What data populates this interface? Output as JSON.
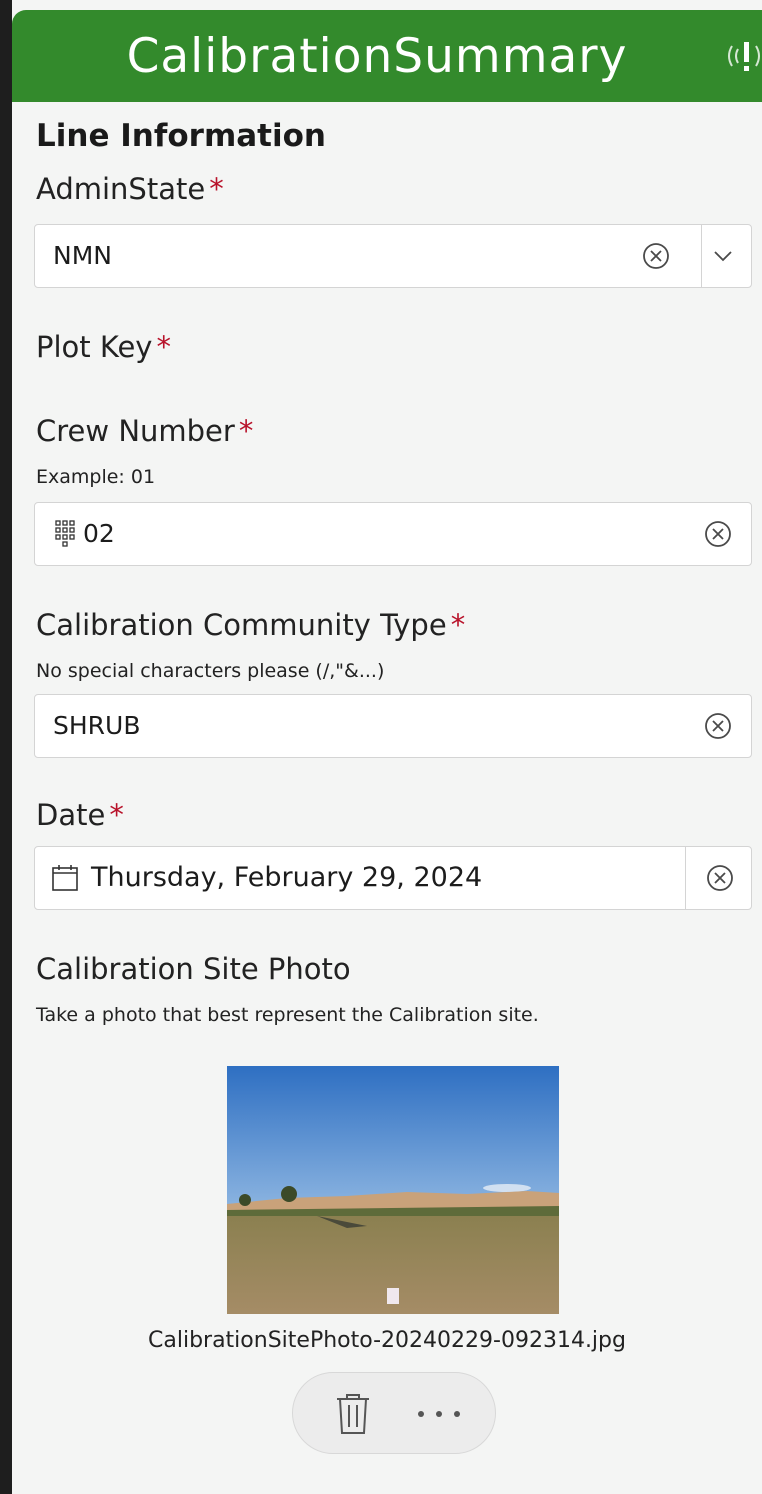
{
  "header": {
    "title": "CalibrationSummary",
    "gps_icon": "gps-warning-icon"
  },
  "section": {
    "title": "Line Information"
  },
  "fields": {
    "admin_state": {
      "label": "AdminState",
      "required_mark": "*",
      "value": "NMN"
    },
    "plot_key": {
      "label": "Plot Key",
      "required_mark": "*"
    },
    "crew_number": {
      "label": "Crew Number",
      "required_mark": "*",
      "hint": "Example: 01",
      "value": "02"
    },
    "community_type": {
      "label": "Calibration Community Type",
      "required_mark": "*",
      "hint": "No special characters please (/,\"&...)",
      "value": "SHRUB"
    },
    "date": {
      "label": "Date",
      "required_mark": "*",
      "value": "Thursday, February 29, 2024"
    },
    "site_photo": {
      "label": "Calibration Site Photo",
      "hint": "Take a photo that best represent the Calibration site.",
      "filename": "CalibrationSitePhoto-20240229-092314.jpg"
    }
  },
  "colors": {
    "header": "#338a2c",
    "required": "#b8122a",
    "background": "#f4f5f4"
  }
}
